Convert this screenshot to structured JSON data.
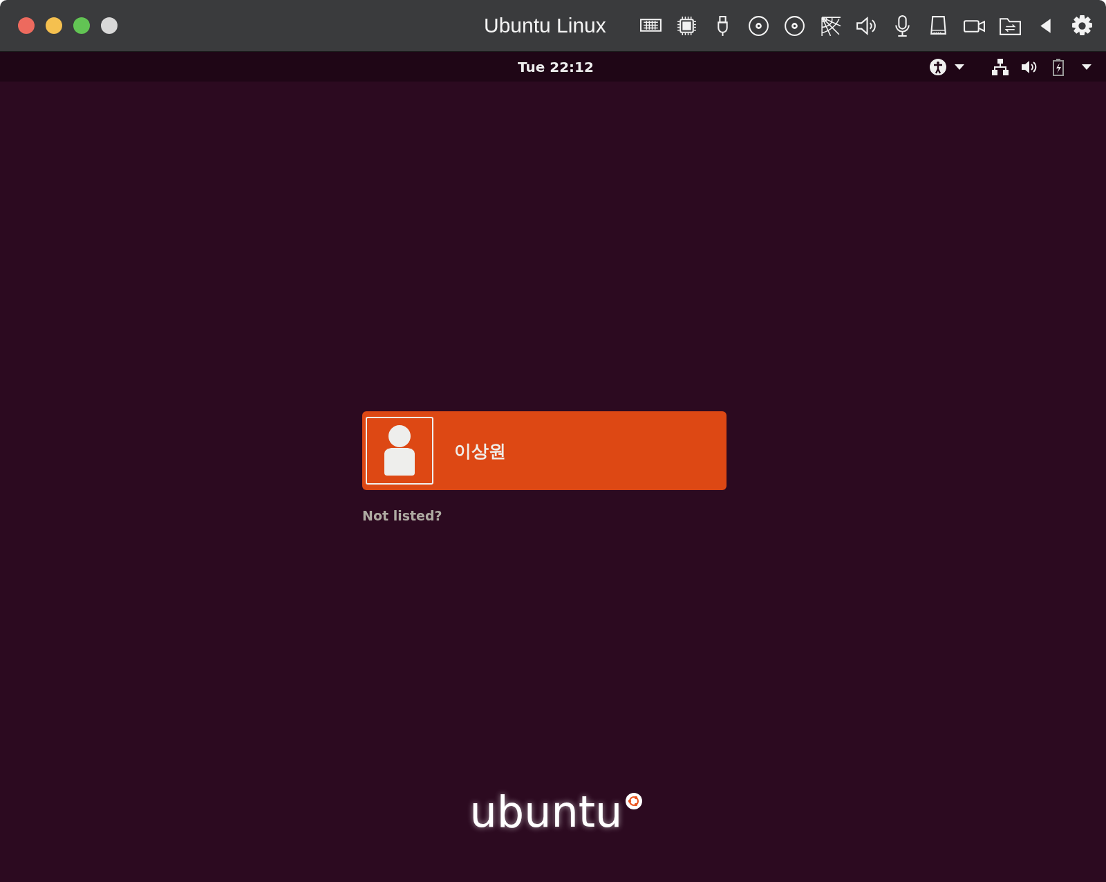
{
  "window": {
    "title": "Ubuntu Linux"
  },
  "top_bar": {
    "clock": "Tue 22:12"
  },
  "users": [
    {
      "name": "이상원",
      "selected": true
    }
  ],
  "not_listed_link": "Not listed?",
  "logo": {
    "wordmark": "ubuntu"
  }
}
